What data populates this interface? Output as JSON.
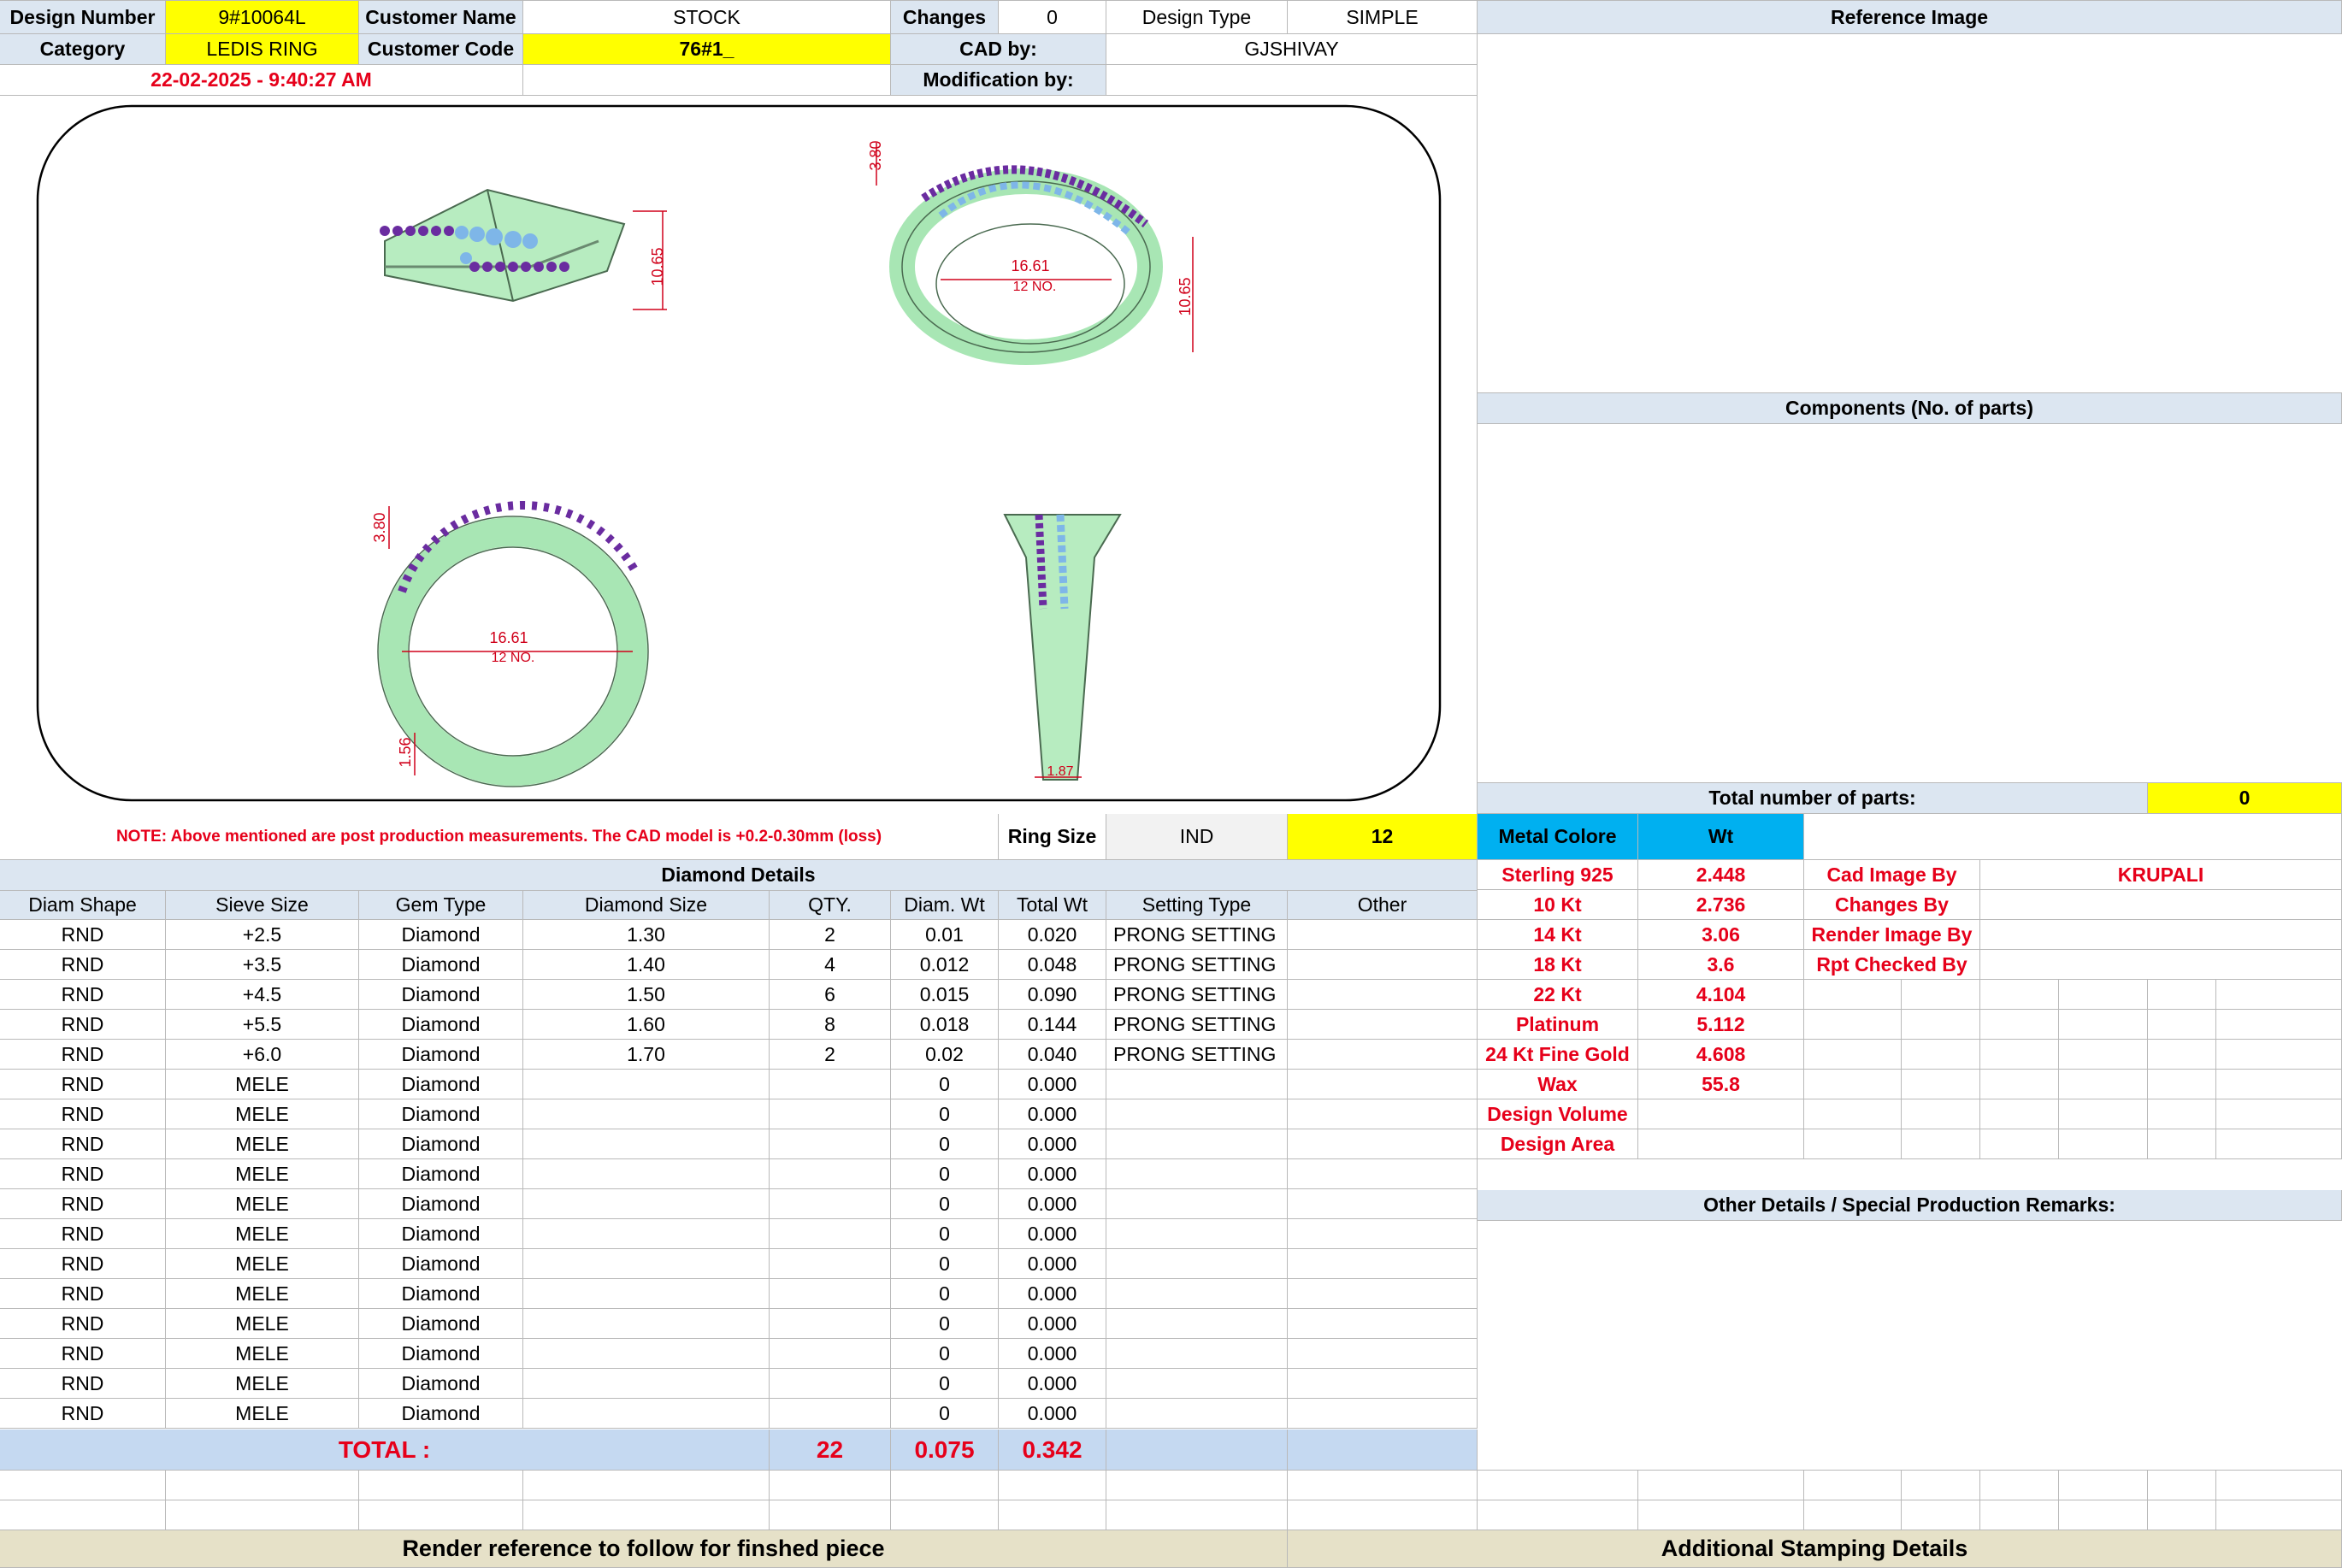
{
  "header": {
    "design_number_label": "Design Number",
    "design_number": "9#10064L",
    "customer_name_label": "Customer Name",
    "customer_name": "STOCK",
    "changes_label": "Changes",
    "changes": "0",
    "design_type_label": "Design Type",
    "design_type": "SIMPLE",
    "category_label": "Category",
    "category": "LEDIS RING",
    "customer_code_label": "Customer Code",
    "customer_code": "76#1_",
    "cad_by_label": "CAD by:",
    "cad_by": "GJSHIVAY",
    "timestamp": "22-02-2025 - 9:40:27 AM",
    "modification_label": "Modification by:"
  },
  "drawing": {
    "dims": {
      "height_1": "10.65",
      "top_1": "3.80",
      "dia_1": "16.61",
      "size_1": "12 NO.",
      "height_2": "10.65",
      "top_2": "3.80",
      "dia_2": "16.61",
      "size_2": "12 NO.",
      "bottom_2": "1.56",
      "bottom_3": "1.87"
    }
  },
  "right_panel": {
    "reference_image": "Reference Image",
    "components": "Components (No. of parts)",
    "total_parts_label": "Total number of parts:",
    "total_parts": "0",
    "metal_colore": "Metal Colore",
    "wt": "Wt",
    "other_details": "Other Details / Special Production Remarks:",
    "additional_stamping": "Additional Stamping Details"
  },
  "note": "NOTE: Above mentioned are post production measurements. The CAD model is +0.2-0.30mm (loss)",
  "ring_size": {
    "label": "Ring Size",
    "standard": "IND",
    "value": "12"
  },
  "diamond": {
    "title": "Diamond Details",
    "columns": [
      "Diam Shape",
      "Sieve Size",
      "Gem Type",
      "Diamond Size",
      "QTY.",
      "Diam. Wt",
      "Total Wt",
      "Setting Type",
      "Other"
    ],
    "rows": [
      [
        "RND",
        "+2.5",
        "Diamond",
        "1.30",
        "2",
        "0.01",
        "0.020",
        "PRONG SETTING",
        ""
      ],
      [
        "RND",
        "+3.5",
        "Diamond",
        "1.40",
        "4",
        "0.012",
        "0.048",
        "PRONG SETTING",
        ""
      ],
      [
        "RND",
        "+4.5",
        "Diamond",
        "1.50",
        "6",
        "0.015",
        "0.090",
        "PRONG SETTING",
        ""
      ],
      [
        "RND",
        "+5.5",
        "Diamond",
        "1.60",
        "8",
        "0.018",
        "0.144",
        "PRONG SETTING",
        ""
      ],
      [
        "RND",
        "+6.0",
        "Diamond",
        "1.70",
        "2",
        "0.02",
        "0.040",
        "PRONG SETTING",
        ""
      ],
      [
        "RND",
        "MELE",
        "Diamond",
        "",
        "",
        "0",
        "0.000",
        "",
        ""
      ],
      [
        "RND",
        "MELE",
        "Diamond",
        "",
        "",
        "0",
        "0.000",
        "",
        ""
      ],
      [
        "RND",
        "MELE",
        "Diamond",
        "",
        "",
        "0",
        "0.000",
        "",
        ""
      ],
      [
        "RND",
        "MELE",
        "Diamond",
        "",
        "",
        "0",
        "0.000",
        "",
        ""
      ],
      [
        "RND",
        "MELE",
        "Diamond",
        "",
        "",
        "0",
        "0.000",
        "",
        ""
      ],
      [
        "RND",
        "MELE",
        "Diamond",
        "",
        "",
        "0",
        "0.000",
        "",
        ""
      ],
      [
        "RND",
        "MELE",
        "Diamond",
        "",
        "",
        "0",
        "0.000",
        "",
        ""
      ],
      [
        "RND",
        "MELE",
        "Diamond",
        "",
        "",
        "0",
        "0.000",
        "",
        ""
      ],
      [
        "RND",
        "MELE",
        "Diamond",
        "",
        "",
        "0",
        "0.000",
        "",
        ""
      ],
      [
        "RND",
        "MELE",
        "Diamond",
        "",
        "",
        "0",
        "0.000",
        "",
        ""
      ],
      [
        "RND",
        "MELE",
        "Diamond",
        "",
        "",
        "0",
        "0.000",
        "",
        ""
      ],
      [
        "RND",
        "MELE",
        "Diamond",
        "",
        "",
        "0",
        "0.000",
        "",
        ""
      ]
    ],
    "total_label": "TOTAL :",
    "total_qty": "22",
    "total_diam_wt": "0.075",
    "total_wt": "0.342"
  },
  "metals": [
    [
      "Sterling 925",
      "2.448"
    ],
    [
      "10 Kt",
      "2.736"
    ],
    [
      "14 Kt",
      "3.06"
    ],
    [
      "18 Kt",
      "3.6"
    ],
    [
      "22 Kt",
      "4.104"
    ],
    [
      "Platinum",
      "5.112"
    ],
    [
      "24 Kt Fine Gold",
      "4.608"
    ],
    [
      "Wax",
      "55.8"
    ],
    [
      "Design Volume",
      ""
    ],
    [
      "Design Area",
      ""
    ]
  ],
  "credits": [
    [
      "Cad Image By",
      "KRUPALI"
    ],
    [
      "Changes By",
      ""
    ],
    [
      "Render Image By",
      ""
    ],
    [
      "Rpt Checked By",
      ""
    ]
  ],
  "footer": {
    "render_reference": "Render reference to follow for finshed piece"
  },
  "colors": {
    "header_blue": "#dce6f1",
    "highlight_yellow": "#ffff00",
    "red_text": "#e6001a",
    "metal_blue": "#00b0f0",
    "total_row": "#c5d9f1",
    "ring_green": "#a8e6b4",
    "stone_purple": "#6a2ca0",
    "stone_blue": "#7eb6e8"
  }
}
